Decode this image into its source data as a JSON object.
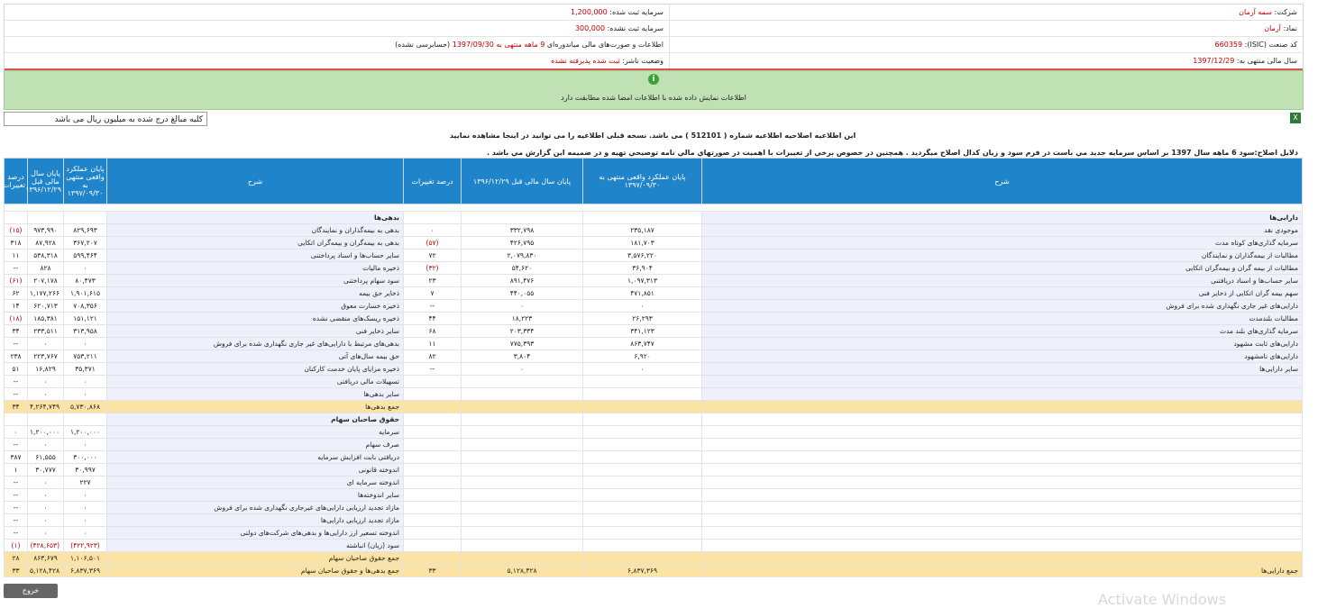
{
  "header": {
    "company_label": "شرکت:",
    "company_value": "سمه آرمان",
    "capital_registered_label": "سرمایه ثبت شده:",
    "capital_registered_value": "1,200,000",
    "symbol_label": "نماد:",
    "symbol_value": "آرمان",
    "capital_unregistered_label": "سرمایه ثبت نشده:",
    "capital_unregistered_value": "300,000",
    "isic_label": "کد صنعت (ISIC):",
    "isic_value": "660359",
    "statement_prefix": "اطلاعات و صورت‌های مالی میاندوره‌ای",
    "statement_period": "9 ماهه منتهی به 1397/09/30",
    "statement_suffix": "(حسابرسی نشده)",
    "fiscal_year_label": "سال مالی منتهی به:",
    "fiscal_year_value": "1397/12/29",
    "publisher_label": "وضعیت ناشر:",
    "publisher_value": "ثبت شده پذیرفته نشده"
  },
  "info_message": "اطلاعات نمایش داده شده با اطلاعات امضا شده مطابقت دارد",
  "unit_note": "کلیه مبالغ درج شده به میلیون ریال می باشد",
  "notice": "این اطلاعیه اصلاحیه اطلاعیه شماره ( 512101 ) می باشد. نسخه قبلی اطلاعیه را می توانید در اینجا مشاهده نمایید",
  "reason": "دلایل اصلاح:سود 6 ماهه سال 1397 بر اساس سرمایه جدید مي باست در فرم سود و زيان كدال اصلاح ميگرديد . همچنين در خصوص برخي از تغييرات با اهميت در صورتهاي مالي نامه توصيحي تهيه و در ضميمه اين گزارش مي باشد .",
  "table": {
    "headers": {
      "desc": "شرح",
      "current": "پایان عملکرد واقعی منتهی به ۱۳۹۷/۰۹/۳۰",
      "previous": "پایان سال مالی قبل ۱۳۹۶/۱۲/۲۹",
      "change": "درصد تغییرات"
    },
    "rows": [
      {
        "r": {
          "label": "دارایی‌ها",
          "c": "",
          "p": "",
          "ch": "",
          "cls": "sec"
        },
        "l": {
          "label": "بدهی‌ها",
          "c": "",
          "p": "",
          "ch": "",
          "cls": "sec"
        }
      },
      {
        "r": {
          "label": "موجودی نقد",
          "c": "۲۳۵,۱۸۷",
          "p": "۳۳۲,۷۹۸",
          "ch": "۰"
        },
        "l": {
          "label": "بدهی به بیمه‌گذاران و نمایندگان",
          "c": "۸۲۹,۶۹۳",
          "p": "۹۷۳,۹۹۰",
          "ch": "(۱۵)",
          "neg": true
        }
      },
      {
        "r": {
          "label": "سرمایه گذاری‌های کوتاه مدت",
          "c": "۱۸۱,۷۰۳",
          "p": "۴۲۶,۷۹۵",
          "ch": "(۵۷)",
          "neg": true
        },
        "l": {
          "label": "بدهی به بیمه‌گران و بیمه‌گران اتکایی",
          "c": "۳۶۷,۲۰۷",
          "p": "۸۷,۹۲۸",
          "ch": "۳۱۸"
        }
      },
      {
        "r": {
          "label": "مطالبات از بیمه‌گذاران و نمایندگان",
          "c": "۳,۵۷۶,۲۲۰",
          "p": "۲,۰۷۹,۸۳۰",
          "ch": "۷۲"
        },
        "l": {
          "label": "سایر حساب‌ها و اسناد پرداختنی",
          "c": "۵۹۹,۴۶۴",
          "p": "۵۳۸,۳۱۸",
          "ch": "۱۱"
        }
      },
      {
        "r": {
          "label": "مطالبات از بیمه گران و بیمه‌گران اتکایی",
          "c": "۳۶,۹۰۴",
          "p": "۵۴,۶۲۰",
          "ch": "(۳۲)",
          "neg": true
        },
        "l": {
          "label": "ذخیره مالیات",
          "c": "۰",
          "p": "۸۲۸",
          "ch": "--"
        }
      },
      {
        "r": {
          "label": "سایر حساب‌ها و اسناد دریافتنی",
          "c": "۱,۰۹۷,۳۱۳",
          "p": "۸۹۱,۴۷۶",
          "ch": "۲۳"
        },
        "l": {
          "label": "سود سهام پرداختنی",
          "c": "۸۰,۴۷۳",
          "p": "۲۰۷,۱۷۸",
          "ch": "(۶۱)",
          "neg": true
        }
      },
      {
        "r": {
          "label": "سهم بیمه گران اتکایی از ذخایر فنی",
          "c": "۴۷۱,۸۵۱",
          "p": "۴۴۰,۰۵۵",
          "ch": "۷"
        },
        "l": {
          "label": "ذخایر حق بیمه",
          "c": "۱,۹۰۱,۶۱۵",
          "p": "۱,۱۷۷,۲۶۶",
          "ch": "۶۲"
        }
      },
      {
        "r": {
          "label": "دارایی‌های غیر جاری نگهداری شده برای فروش",
          "c": "۰",
          "p": "۰",
          "ch": "--"
        },
        "l": {
          "label": "ذخیره خسارت معوق",
          "c": "۷۰۸,۳۵۶",
          "p": "۶۲۰,۷۱۳",
          "ch": "۱۴"
        }
      },
      {
        "r": {
          "label": "مطالبات بلندمدت",
          "c": "۲۶,۲۹۳",
          "p": "۱۸,۲۲۳",
          "ch": "۴۴"
        },
        "l": {
          "label": "ذخیره ریسک‌های منقضی نشده",
          "c": "۱۵۱,۱۲۱",
          "p": "۱۸۵,۳۸۱",
          "ch": "(۱۸)",
          "neg": true
        }
      },
      {
        "r": {
          "label": "سرمایه گذاری‌های بلند مدت",
          "c": "۳۴۱,۱۲۳",
          "p": "۲۰۳,۳۳۴",
          "ch": "۶۸"
        },
        "l": {
          "label": "سایر ذخایر فنی",
          "c": "۳۱۳,۹۵۸",
          "p": "۲۳۳,۵۱۱",
          "ch": "۳۴"
        }
      },
      {
        "r": {
          "label": "دارایی‌های ثابت مشهود",
          "c": "۸۶۳,۷۴۷",
          "p": "۷۷۵,۳۹۳",
          "ch": "۱۱"
        },
        "l": {
          "label": "بدهی‌های مرتبط با دارایی‌های غیر جاری نگهداری شده برای فروش",
          "c": "۰",
          "p": "۰",
          "ch": "--"
        }
      },
      {
        "r": {
          "label": "دارایی‌های نامشهود",
          "c": "۶,۹۲۰",
          "p": "۳,۸۰۴",
          "ch": "۸۲"
        },
        "l": {
          "label": "حق بیمه سال‌های آتی",
          "c": "۷۵۳,۲۱۱",
          "p": "۲۲۳,۷۶۷",
          "ch": "۲۳۸"
        }
      },
      {
        "r": {
          "label": "سایر دارایی‌ها",
          "c": "۰",
          "p": "۰",
          "ch": "--"
        },
        "l": {
          "label": "ذخیره مزایای پایان خدمت کارکنان",
          "c": "۳۵,۳۷۱",
          "p": "۱۶,۸۲۹",
          "ch": "۵۱"
        }
      },
      {
        "r": {
          "label": "",
          "c": "",
          "p": "",
          "ch": ""
        },
        "l": {
          "label": "تسهیلات مالی دریافتی",
          "c": "۰",
          "p": "۰",
          "ch": "--"
        }
      },
      {
        "r": {
          "label": "",
          "c": "",
          "p": "",
          "ch": ""
        },
        "l": {
          "label": "سایر بدهی‌ها",
          "c": "۰",
          "p": "۰",
          "ch": "--"
        }
      },
      {
        "r": {
          "label": "",
          "c": "",
          "p": "",
          "ch": "",
          "blank": true
        },
        "l": {
          "label": "جمع بدهی‌ها",
          "c": "۵,۷۳۰,۸۶۸",
          "p": "۴,۲۶۴,۷۴۹",
          "ch": "۳۴",
          "cls": "tot"
        }
      },
      {
        "r": {
          "label": "",
          "c": "",
          "p": "",
          "ch": "",
          "blank": true
        },
        "l": {
          "label": "حقوق صاحبان سهام",
          "c": "",
          "p": "",
          "ch": "",
          "cls": "sec"
        }
      },
      {
        "r": {
          "label": "",
          "c": "",
          "p": "",
          "ch": "",
          "blank": true
        },
        "l": {
          "label": "سرمایه",
          "c": "۱,۲۰۰,۰۰۰",
          "p": "۱,۲۰۰,۰۰۰",
          "ch": "۰"
        }
      },
      {
        "r": {
          "label": "",
          "c": "",
          "p": "",
          "ch": "",
          "blank": true
        },
        "l": {
          "label": "صرف سهام",
          "c": "۰",
          "p": "۰",
          "ch": "--"
        }
      },
      {
        "r": {
          "label": "",
          "c": "",
          "p": "",
          "ch": "",
          "blank": true
        },
        "l": {
          "label": "دریافتی بابت افزایش سرمایه",
          "c": "۳۰۰,۰۰۰",
          "p": "۶۱,۵۵۵",
          "ch": "۳۸۷"
        }
      },
      {
        "r": {
          "label": "",
          "c": "",
          "p": "",
          "ch": "",
          "blank": true
        },
        "l": {
          "label": "اندوخته قانونی",
          "c": "۳۰,۹۹۷",
          "p": "۳۰,۷۷۷",
          "ch": "۱"
        }
      },
      {
        "r": {
          "label": "",
          "c": "",
          "p": "",
          "ch": "",
          "blank": true
        },
        "l": {
          "label": "اندوخته سرمایه ای",
          "c": "۲۲۷",
          "p": "۰",
          "ch": "--"
        }
      },
      {
        "r": {
          "label": "",
          "c": "",
          "p": "",
          "ch": "",
          "blank": true
        },
        "l": {
          "label": "سایر اندوخته‌ها",
          "c": "۰",
          "p": "۰",
          "ch": "--"
        }
      },
      {
        "r": {
          "label": "",
          "c": "",
          "p": "",
          "ch": "",
          "blank": true
        },
        "l": {
          "label": "مازاد تجدید ارزیابی دارایی‌های غیرجاری نگهداری شده برای فروش",
          "c": "۰",
          "p": "۰",
          "ch": "--"
        }
      },
      {
        "r": {
          "label": "",
          "c": "",
          "p": "",
          "ch": "",
          "blank": true
        },
        "l": {
          "label": "مازاد تجدید ارزیابی دارایی‌ها",
          "c": "۰",
          "p": "۰",
          "ch": "--"
        }
      },
      {
        "r": {
          "label": "",
          "c": "",
          "p": "",
          "ch": "",
          "blank": true
        },
        "l": {
          "label": "اندوخته تسعیر ارز دارایی‌ها و بدهی‌های شرکت‌های دولتی",
          "c": "۰",
          "p": "۰",
          "ch": "--"
        }
      },
      {
        "r": {
          "label": "",
          "c": "",
          "p": "",
          "ch": "",
          "blank": true
        },
        "l": {
          "label": "سود (زیان) انباشته",
          "c": "(۴۲۲,۹۲۳)",
          "p": "(۴۲۸,۶۵۳)",
          "ch": "(۱)",
          "neg": true,
          "negAll": true
        }
      },
      {
        "r": {
          "label": "",
          "c": "",
          "p": "",
          "ch": "",
          "blank": true
        },
        "l": {
          "label": "جمع حقوق صاحبان سهام",
          "c": "۱,۱۰۶,۵۰۱",
          "p": "۸۶۳,۶۷۹",
          "ch": "۲۸",
          "cls": "tot"
        }
      },
      {
        "r": {
          "label": "جمع دارایی‌ها",
          "c": "۶,۸۳۷,۳۶۹",
          "p": "۵,۱۲۸,۴۲۸",
          "ch": "۳۳",
          "cls": "tot"
        },
        "l": {
          "label": "جمع بدهی‌ها و حقوق صاحبان سهام",
          "c": "۶,۸۳۷,۳۶۹",
          "p": "۵,۱۲۸,۴۲۸",
          "ch": "۳۳",
          "cls": "tot"
        }
      }
    ]
  },
  "exit_label": "خروج",
  "watermark": "Activate Windows"
}
